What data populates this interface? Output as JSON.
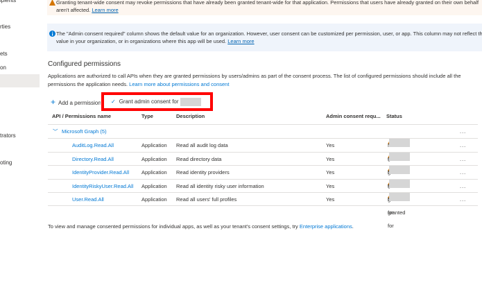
{
  "sidebar": {
    "items": [
      "ipients",
      "rties",
      "ets",
      "on",
      "",
      "trators",
      "oting"
    ]
  },
  "warning_banner": {
    "text": "Granting tenant-wide consent may revoke permissions that have already been granted tenant-wide for that application. Permissions that users have already granted on their own behalf aren't affected.",
    "link": "Learn more"
  },
  "info_banner": {
    "text": "The \"Admin consent required\" column shows the default value for an organization. However, user consent can be customized per permission, user, or app. This column may not reflect the value in your organization, or in organizations where this app will be used.",
    "link": "Learn more"
  },
  "section": {
    "title": "Configured permissions",
    "description": "Applications are authorized to call APIs when they are granted permissions by users/admins as part of the consent process. The list of configured permissions should include all the permissions the application needs.",
    "link": "Learn more about permissions and consent"
  },
  "toolbar": {
    "add_label": "Add a permission",
    "grant_label": "Grant admin consent for"
  },
  "table": {
    "headers": [
      "API / Permissions name",
      "Type",
      "Description",
      "Admin consent requ...",
      "Status"
    ],
    "group": "Microsoft Graph (5)",
    "rows": [
      {
        "name": "AuditLog.Read.All",
        "type": "Application",
        "description": "Read all audit log data",
        "admin": "Yes",
        "status": "Not granted for"
      },
      {
        "name": "Directory.Read.All",
        "type": "Application",
        "description": "Read directory data",
        "admin": "Yes",
        "status": "Not granted for"
      },
      {
        "name": "IdentityProvider.Read.All",
        "type": "Application",
        "description": "Read identity providers",
        "admin": "Yes",
        "status": "Not granted for"
      },
      {
        "name": "IdentityRiskyUser.Read.All",
        "type": "Application",
        "description": "Read all identity risky user information",
        "admin": "Yes",
        "status": "Not granted for"
      },
      {
        "name": "User.Read.All",
        "type": "Application",
        "description": "Read all users' full profiles",
        "admin": "Yes",
        "status": "Not granted for"
      }
    ],
    "more": "..."
  },
  "footer": {
    "text": "To view and manage consented permissions for individual apps, as well as your tenant's consent settings, try",
    "link": "Enterprise applications",
    "end": "."
  }
}
